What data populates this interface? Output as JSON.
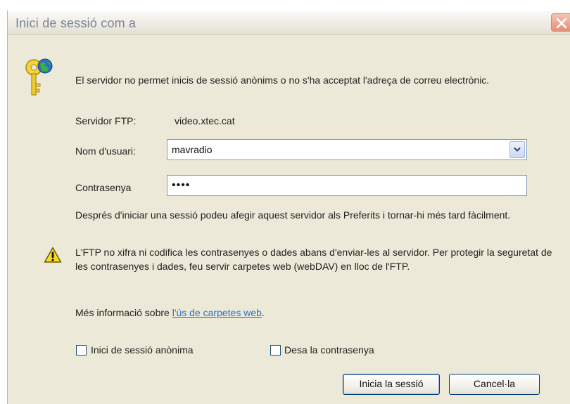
{
  "window": {
    "title": "Inici de sessió com a",
    "close_icon": "close-icon"
  },
  "message": {
    "text": "El servidor no permet inicis de sessió anònims o no s'ha acceptat l'adreça de correu electrònic.",
    "icon": "key-globe-icon"
  },
  "form": {
    "server_label": "Servidor FTP:",
    "server_value": "video.xtec.cat",
    "user_label": "Nom d'usuari:",
    "user_value": "mavradio",
    "password_label": "Contrasenya",
    "password_value": "••••"
  },
  "info_text": "Després d'iniciar una sessió podeu afegir aquest servidor als Preferits i tornar-hi més tard fàcilment.",
  "warning": {
    "icon": "warning-icon",
    "text": "L'FTP no xifra ni codifica les contrasenyes o dades abans d'enviar-les al servidor. Per protegir la seguretat de les contrasenyes i dades, feu servir carpetes web (webDAV) en lloc de l'FTP.",
    "more_prefix": "Més informació sobre ",
    "more_link": "l'ús de carpetes web",
    "more_suffix": "."
  },
  "checkboxes": {
    "anonymous_label": "Inici de sessió anònima",
    "anonymous_checked": false,
    "save_password_label": "Desa la contrasenya",
    "save_password_checked": false
  },
  "buttons": {
    "login": "Inicia la sessió",
    "cancel": "Cancel·la"
  },
  "colors": {
    "dialog_bg": "#ece9d8",
    "link": "#2a6fc9",
    "close_button": "#e58f75"
  }
}
